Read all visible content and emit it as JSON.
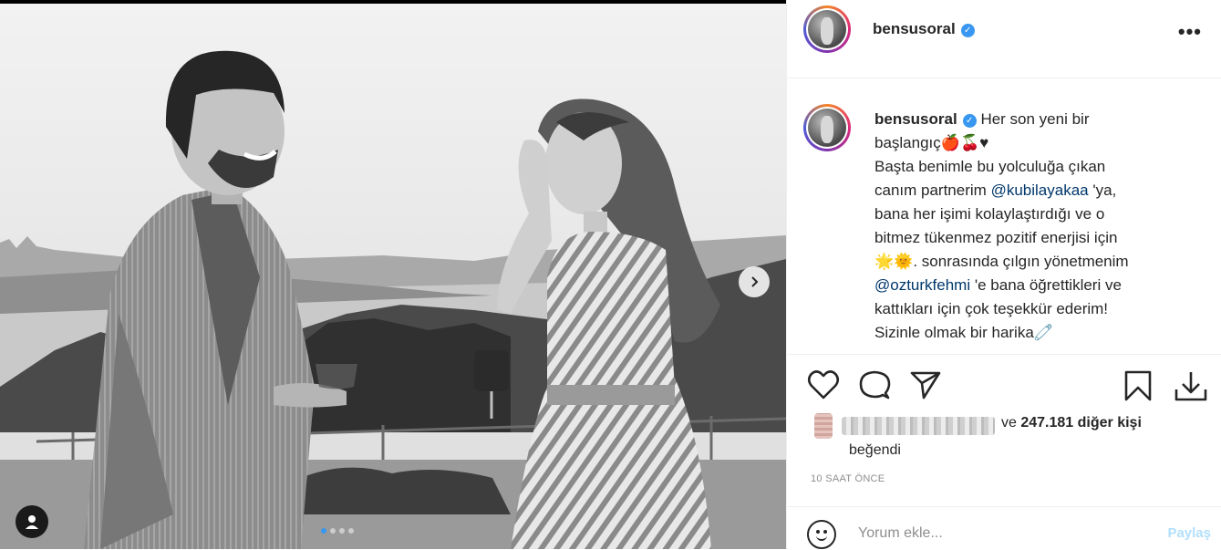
{
  "post": {
    "username": "bensusoral",
    "verified_mark": "✓",
    "more_label": "•••",
    "caption": {
      "lines": [
        "Her son yeni bir",
        "başlangıç",
        "Başta benimle bu yolculuğa çıkan",
        "canım partnerim",
        "@kubilayakaa",
        "'ya,",
        "bana her işimi kolaylaştırdığı ve o",
        "bitmez tükenmez pozitif enerjisi için",
        ". sonrasında çılgın yönetmenim",
        "@ozturkfehmi",
        "'e bana öğrettikleri ve",
        "kattıkları için çok teşekkür ederim!",
        "Sizinle olmak bir harika"
      ],
      "emojis": {
        "line2": "🍎🍒♥",
        "line8": "🌟🌞",
        "line13": "🧷"
      }
    },
    "likes": {
      "prefix": "ve",
      "count": "247.181 diğer kişi",
      "suffix": "beğendi"
    },
    "timestamp": "10 SAAT ÖNCE",
    "comment": {
      "placeholder": "Yorum ekle...",
      "post_label": "Paylaş"
    }
  },
  "icons": {
    "like": "heart-icon",
    "comment": "comment-icon",
    "share": "paper-plane-icon",
    "save": "bookmark-icon",
    "download": "download-icon",
    "next": "chevron-right-icon",
    "tag": "user-tag-icon",
    "emoji": "emoji-icon"
  },
  "carousel": {
    "count": 4,
    "active": 1
  },
  "colors": {
    "accent": "#3897f0",
    "mention": "#00376b",
    "muted": "#8e8e8e",
    "post_button_disabled": "#b2dffc",
    "divider": "#efefef"
  }
}
